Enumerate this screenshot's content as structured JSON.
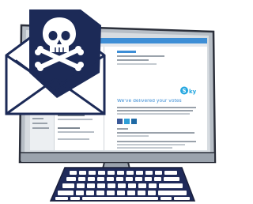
{
  "illustration": {
    "subject": "phishing email on desktop computer",
    "icons": [
      "envelope-icon",
      "skull-crossbones-icon",
      "monitor-icon",
      "keyboard-icon",
      "skype-logo-icon",
      "facebook-icon",
      "twitter-icon",
      "linkedin-icon"
    ],
    "colors": {
      "envelope_navy": "#1c2a57",
      "monitor_frame": "#9ba3ad",
      "monitor_outline": "#2b2f3a",
      "screen_bg": "#f4f6f8",
      "email_accent": "#3d8ed6",
      "skype_blue": "#27a8e0",
      "facebook_blue": "#3b5998",
      "twitter_blue": "#2f9fd8",
      "linkedin_blue": "#1f6aa5",
      "keyboard_navy": "#1f2a5a",
      "keyboard_keys": "#ffffff"
    }
  },
  "email": {
    "heading": "We've delivered your votes"
  }
}
